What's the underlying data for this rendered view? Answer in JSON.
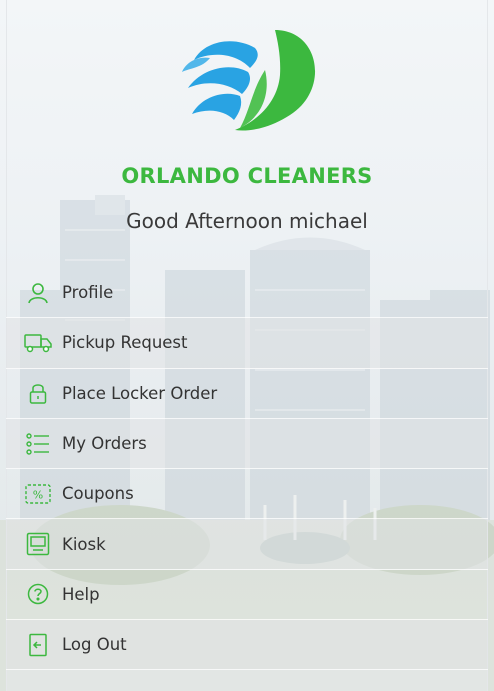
{
  "brand": {
    "name": "ORLANDO CLEANERS",
    "logo_icon": "water-splash-leaf-logo",
    "colors": {
      "blue": "#29a3e3",
      "green": "#3cb83f"
    }
  },
  "greeting": "Good Afternoon michael",
  "menu": {
    "items": [
      {
        "label": "Profile",
        "icon": "person-icon"
      },
      {
        "label": "Pickup Request",
        "icon": "truck-icon"
      },
      {
        "label": "Place Locker Order",
        "icon": "lock-icon"
      },
      {
        "label": "My Orders",
        "icon": "list-icon"
      },
      {
        "label": "Coupons",
        "icon": "coupon-icon"
      },
      {
        "label": "Kiosk",
        "icon": "kiosk-icon"
      },
      {
        "label": "Help",
        "icon": "help-icon"
      },
      {
        "label": "Log Out",
        "icon": "logout-icon"
      }
    ]
  }
}
